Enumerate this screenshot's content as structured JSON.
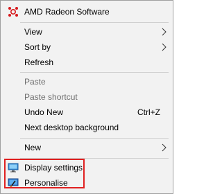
{
  "menu": {
    "amd": {
      "label": "AMD Radeon Software",
      "icon": "amd-radeon-icon"
    },
    "view": {
      "label": "View"
    },
    "sort_by": {
      "label": "Sort by"
    },
    "refresh": {
      "label": "Refresh"
    },
    "paste": {
      "label": "Paste"
    },
    "paste_shortcut": {
      "label": "Paste shortcut"
    },
    "undo_new": {
      "label": "Undo New",
      "shortcut": "Ctrl+Z"
    },
    "next_bg": {
      "label": "Next desktop background"
    },
    "new": {
      "label": "New"
    },
    "display_settings": {
      "label": "Display settings",
      "icon": "display-settings-icon"
    },
    "personalise": {
      "label": "Personalise",
      "icon": "personalise-icon"
    }
  },
  "colors": {
    "menu_background": "#f2f2f2",
    "disabled_text": "#6d6d6d",
    "highlight_border": "#e02020",
    "amd_icon": "#d7191c"
  }
}
